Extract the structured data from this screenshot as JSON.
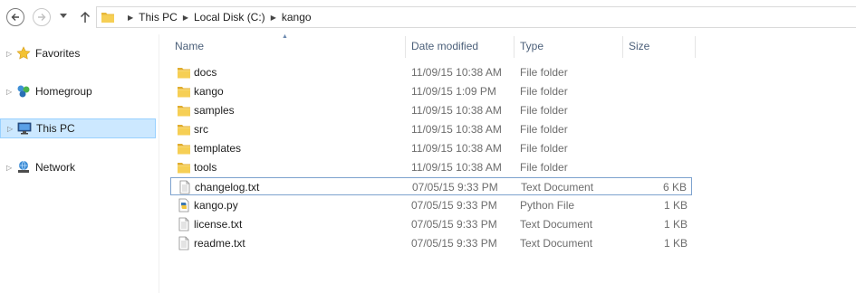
{
  "address_bar": {
    "crumbs": [
      "This PC",
      "Local Disk (C:)",
      "kango"
    ]
  },
  "nav_pane": {
    "items": [
      {
        "label": "Favorites",
        "icon": "star-icon",
        "selected": false
      },
      {
        "label": "Homegroup",
        "icon": "homegroup-icon",
        "selected": false
      },
      {
        "label": "This PC",
        "icon": "computer-icon",
        "selected": true
      },
      {
        "label": "Network",
        "icon": "network-icon",
        "selected": false
      }
    ]
  },
  "columns": {
    "name": "Name",
    "date_modified": "Date modified",
    "type": "Type",
    "size": "Size"
  },
  "files": [
    {
      "name": "docs",
      "date": "11/09/15 10:38 AM",
      "type": "File folder",
      "size": "",
      "icon": "folder-icon"
    },
    {
      "name": "kango",
      "date": "11/09/15 1:09 PM",
      "type": "File folder",
      "size": "",
      "icon": "folder-icon"
    },
    {
      "name": "samples",
      "date": "11/09/15 10:38 AM",
      "type": "File folder",
      "size": "",
      "icon": "folder-icon"
    },
    {
      "name": "src",
      "date": "11/09/15 10:38 AM",
      "type": "File folder",
      "size": "",
      "icon": "folder-icon"
    },
    {
      "name": "templates",
      "date": "11/09/15 10:38 AM",
      "type": "File folder",
      "size": "",
      "icon": "folder-icon"
    },
    {
      "name": "tools",
      "date": "11/09/15 10:38 AM",
      "type": "File folder",
      "size": "",
      "icon": "folder-icon"
    },
    {
      "name": "changelog.txt",
      "date": "07/05/15 9:33 PM",
      "type": "Text Document",
      "size": "6 KB",
      "icon": "text-file-icon",
      "selected": true
    },
    {
      "name": "kango.py",
      "date": "07/05/15 9:33 PM",
      "type": "Python File",
      "size": "1 KB",
      "icon": "python-file-icon"
    },
    {
      "name": "license.txt",
      "date": "07/05/15 9:33 PM",
      "type": "Text Document",
      "size": "1 KB",
      "icon": "text-file-icon"
    },
    {
      "name": "readme.txt",
      "date": "07/05/15 9:33 PM",
      "type": "Text Document",
      "size": "1 KB",
      "icon": "text-file-icon"
    }
  ],
  "colors": {
    "selection_bg": "#cce8ff",
    "selection_border": "#99d1ff",
    "row_focus_border": "#7da2ce",
    "header_text": "#4c607a",
    "folder_yellow": "#f6cf55"
  }
}
